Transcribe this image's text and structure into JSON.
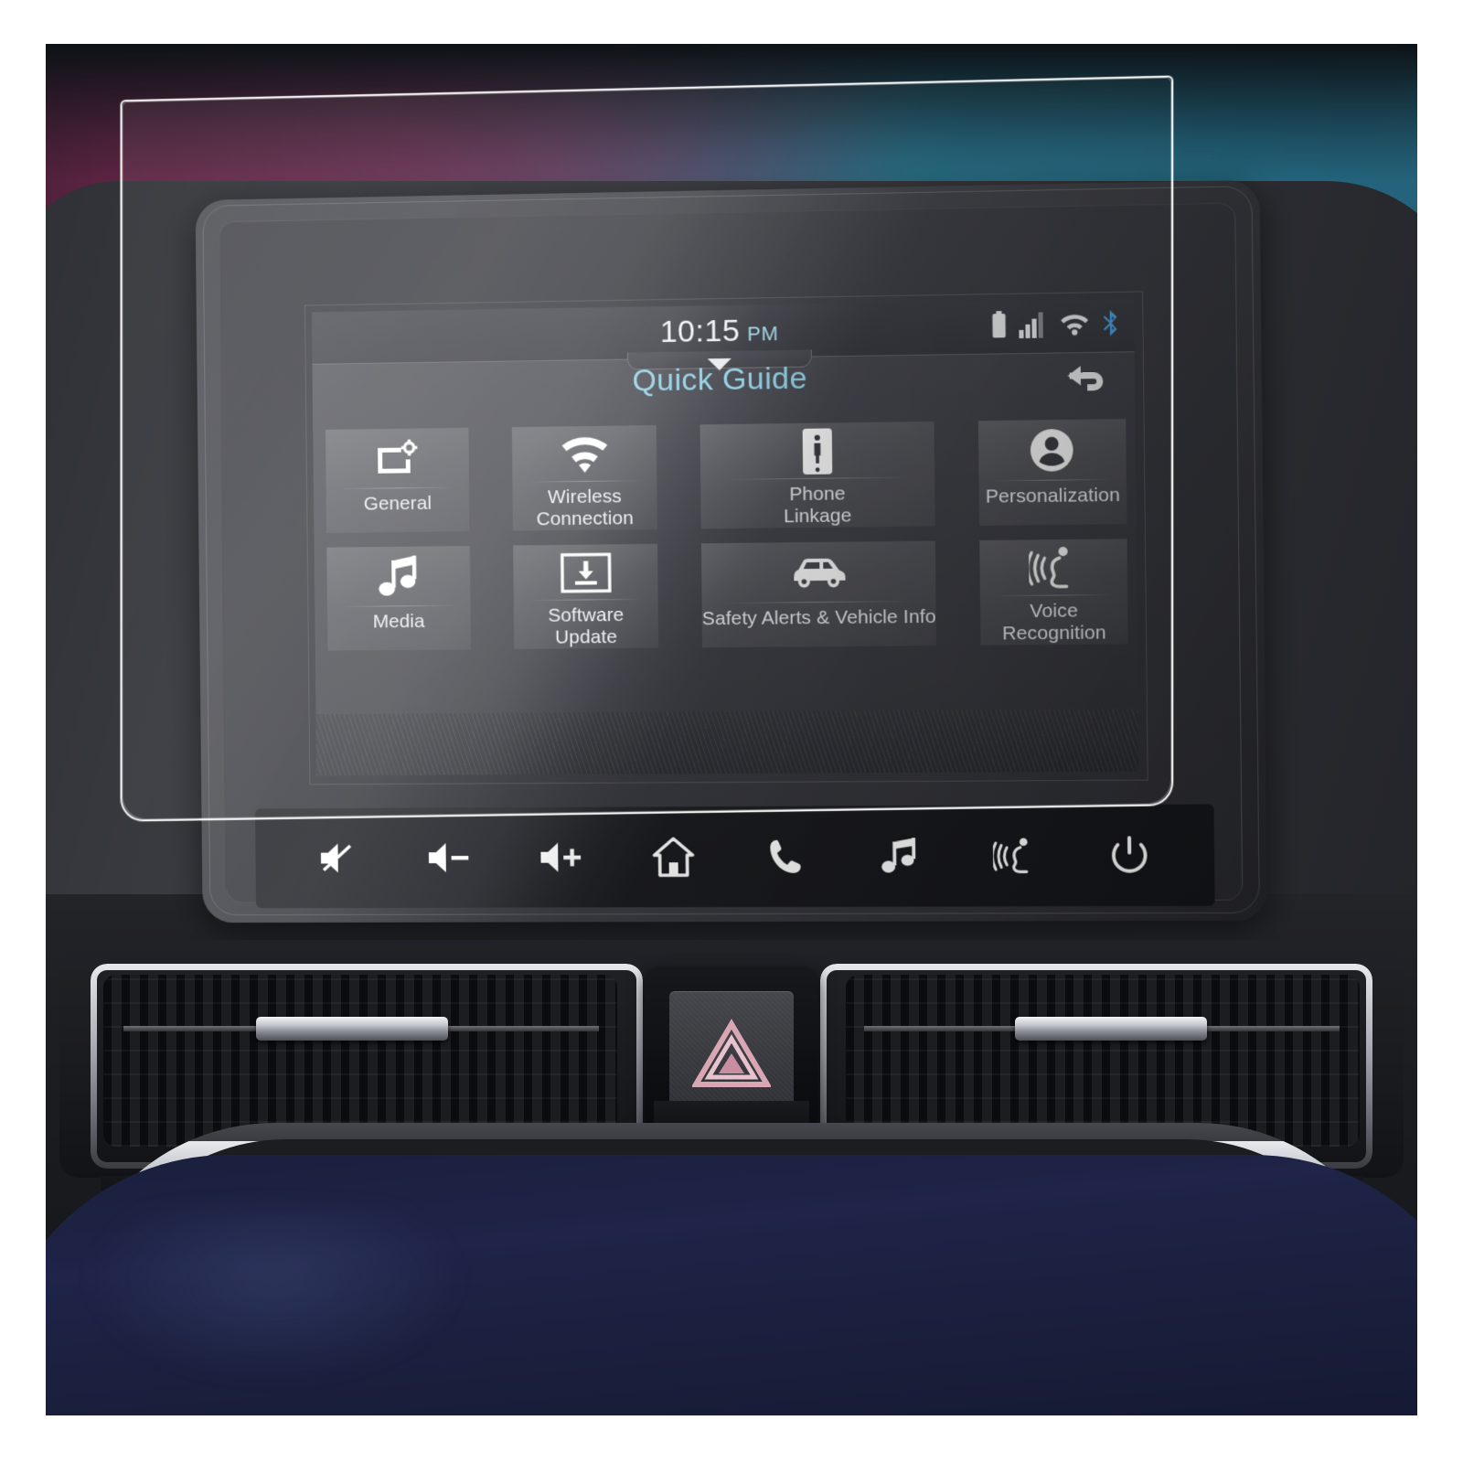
{
  "product": {
    "scene": "car-infotainment-screen-protector"
  },
  "screen": {
    "status_bar": {
      "time": "10:15",
      "meridiem": "PM",
      "icons": [
        "battery-icon",
        "signal-icon",
        "wifi-icon",
        "bluetooth-icon"
      ],
      "signal_bars_filled": 3,
      "signal_bars_total": 4
    },
    "title": "Quick Guide",
    "title_color": "#8fd2e6",
    "back_button": "back-icon",
    "tiles": [
      {
        "label": "General",
        "icon": "display-settings-icon"
      },
      {
        "label": "Wireless\nConnection",
        "icon": "wifi-icon"
      },
      {
        "label": "Phone\nLinkage",
        "icon": "smartphone-icon"
      },
      {
        "label": "Personalization",
        "icon": "user-profile-icon"
      },
      {
        "label": "Media",
        "icon": "music-note-icon"
      },
      {
        "label": "Software\nUpdate",
        "icon": "software-update-icon"
      },
      {
        "label": "Safety Alerts &\nVehicle Info",
        "icon": "car-icon"
      },
      {
        "label": "Voice\nRecognition",
        "icon": "voice-recognition-icon"
      }
    ]
  },
  "hardkeys": [
    {
      "name": "mute-button",
      "icon": "speaker-mute-icon"
    },
    {
      "name": "volume-down-button",
      "icon": "speaker-minus-icon"
    },
    {
      "name": "volume-up-button",
      "icon": "speaker-plus-icon"
    },
    {
      "name": "home-button",
      "icon": "home-icon"
    },
    {
      "name": "phone-button",
      "icon": "phone-handset-icon"
    },
    {
      "name": "media-button",
      "icon": "music-note-icon"
    },
    {
      "name": "voice-button",
      "icon": "voice-recognition-icon"
    },
    {
      "name": "power-button",
      "icon": "power-icon"
    }
  ],
  "dashboard": {
    "hazard_button_icon": "hazard-triangle-icon",
    "hazard_color": "#d9a6b4",
    "vents": [
      "left-air-vent",
      "right-air-vent"
    ],
    "trim_color": "#1f2448"
  }
}
